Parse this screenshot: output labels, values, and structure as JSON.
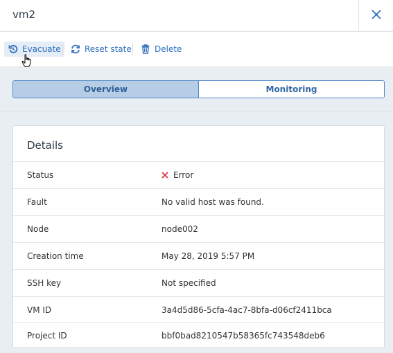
{
  "panel": {
    "title": "vm2"
  },
  "toolbar": {
    "evacuate_label": "Evacuate",
    "reset_label": "Reset state",
    "delete_label": "Delete"
  },
  "tabs": [
    {
      "label": "Overview",
      "active": true
    },
    {
      "label": "Monitoring",
      "active": false
    }
  ],
  "details": {
    "title": "Details",
    "rows": [
      {
        "key": "Status",
        "value": "Error",
        "icon": "error-x-icon"
      },
      {
        "key": "Fault",
        "value": "No valid host was found."
      },
      {
        "key": "Node",
        "value": "node002"
      },
      {
        "key": "Creation time",
        "value": "May 28, 2019 5:57 PM"
      },
      {
        "key": "SSH key",
        "value": "Not specified"
      },
      {
        "key": "VM ID",
        "value": "3a4d5d86-5cfa-4ac7-8bfa-d06cf2411bca"
      },
      {
        "key": "Project ID",
        "value": "bbf0bad8210547b58365fc743548deb6"
      }
    ]
  },
  "colors": {
    "accent": "#2e6fbf",
    "error": "#d9333f",
    "active_tab": "#b7cde6"
  }
}
